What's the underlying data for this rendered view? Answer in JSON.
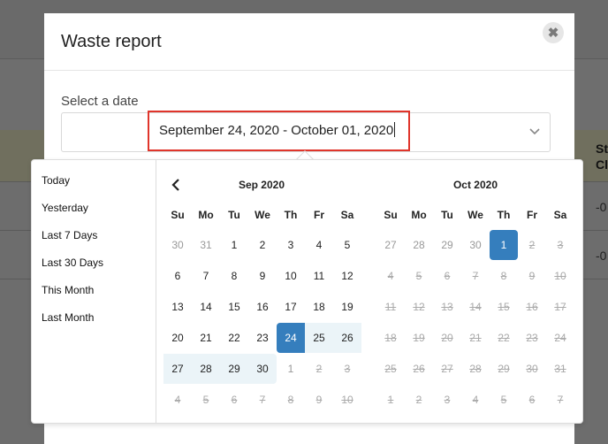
{
  "modal": {
    "title": "Waste report",
    "field_label": "Select a date",
    "date_value": "September 24, 2020 - October 01, 2020",
    "close_symbol": "✖"
  },
  "background": {
    "partial_header_1": "St",
    "partial_header_2": "Cl",
    "row_values": [
      "-0",
      "-0"
    ]
  },
  "ranges": [
    "Today",
    "Yesterday",
    "Last 7 Days",
    "Last 30 Days",
    "This Month",
    "Last Month"
  ],
  "calendars": [
    {
      "title": "Sep 2020",
      "weekdays": [
        "Su",
        "Mo",
        "Tu",
        "We",
        "Th",
        "Fr",
        "Sa"
      ],
      "weeks": [
        [
          "30",
          "31",
          "1",
          "2",
          "3",
          "4",
          "5"
        ],
        [
          "6",
          "7",
          "8",
          "9",
          "10",
          "11",
          "12"
        ],
        [
          "13",
          "14",
          "15",
          "16",
          "17",
          "18",
          "19"
        ],
        [
          "20",
          "21",
          "22",
          "23",
          "24",
          "25",
          "26"
        ],
        [
          "27",
          "28",
          "29",
          "30",
          "1",
          "2",
          "3"
        ],
        [
          "4",
          "5",
          "6",
          "7",
          "8",
          "9",
          "10"
        ]
      ]
    },
    {
      "title": "Oct 2020",
      "weekdays": [
        "Su",
        "Mo",
        "Tu",
        "We",
        "Th",
        "Fr",
        "Sa"
      ],
      "weeks": [
        [
          "27",
          "28",
          "29",
          "30",
          "1",
          "2",
          "3"
        ],
        [
          "4",
          "5",
          "6",
          "7",
          "8",
          "9",
          "10"
        ],
        [
          "11",
          "12",
          "13",
          "14",
          "15",
          "16",
          "17"
        ],
        [
          "18",
          "19",
          "20",
          "21",
          "22",
          "23",
          "24"
        ],
        [
          "25",
          "26",
          "27",
          "28",
          "29",
          "30",
          "31"
        ],
        [
          "1",
          "2",
          "3",
          "4",
          "5",
          "6",
          "7"
        ]
      ]
    }
  ],
  "colors": {
    "active": "#357ebd",
    "in_range": "#ebf4f8",
    "highlight_border": "#e0352b"
  }
}
